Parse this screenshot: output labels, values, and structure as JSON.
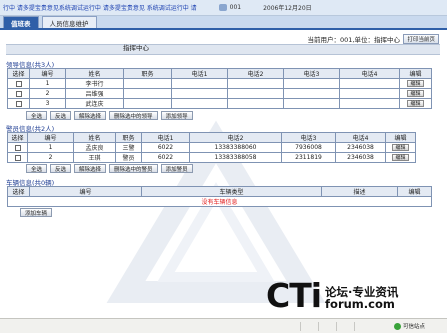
{
  "ticker": {
    "text": "行中 请多提宝贵意见系统调试运行中 请多提宝贵意见 系统调试运行中 请",
    "user_id": "001",
    "date": "2006年12月20日"
  },
  "tabs": [
    {
      "label": "值班表",
      "active": true
    },
    {
      "label": "人员信息维护",
      "active": false
    }
  ],
  "header": {
    "current_user": "当前用户：001,单位：指挥中心",
    "print_label": "打印当前页",
    "center_title": "指挥中心"
  },
  "leaders": {
    "title": "领导信息(共3人)",
    "columns": [
      "选择",
      "编号",
      "姓名",
      "职务",
      "电话1",
      "电话2",
      "电话3",
      "电话4",
      "编辑"
    ],
    "rows": [
      {
        "no": "1",
        "name": "李书行",
        "title": "",
        "tel1": "",
        "tel2": "",
        "tel3": "",
        "tel4": "",
        "edit": "编辑"
      },
      {
        "no": "2",
        "name": "吕维强",
        "title": "",
        "tel1": "",
        "tel2": "",
        "tel3": "",
        "tel4": "",
        "edit": "编辑"
      },
      {
        "no": "3",
        "name": "武连庆",
        "title": "",
        "tel1": "",
        "tel2": "",
        "tel3": "",
        "tel4": "",
        "edit": "编辑"
      }
    ],
    "buttons": [
      "全选",
      "反选",
      "解除选择",
      "删除选中的领导",
      "添加领导"
    ]
  },
  "police": {
    "title": "警员信息(共2人)",
    "columns": [
      "选择",
      "编号",
      "姓名",
      "职务",
      "电话1",
      "电话2",
      "电话3",
      "电话4",
      "编辑"
    ],
    "rows": [
      {
        "no": "1",
        "name": "孟庆良",
        "title": "三警",
        "tel1": "6022",
        "tel2": "13383388060",
        "tel3": "7936008",
        "tel4": "2346038",
        "edit": "编辑"
      },
      {
        "no": "2",
        "name": "王琪",
        "title": "警员",
        "tel1": "6022",
        "tel2": "13383388058",
        "tel3": "2311819",
        "tel4": "2346038",
        "edit": "编辑"
      }
    ],
    "buttons": [
      "全选",
      "反选",
      "解除选择",
      "删除选中的警员",
      "添加警员"
    ]
  },
  "vehicles": {
    "title": "车辆信息(共0辆)",
    "columns": [
      "选择",
      "编号",
      "车辆类型",
      "描述",
      "编辑"
    ],
    "empty_text": "没有车辆信息",
    "buttons": [
      "添加车辆"
    ]
  },
  "logo": {
    "big": "CTi",
    "line1": "论坛·专业资讯",
    "line2": "forum.com"
  },
  "statusbar": {
    "trusted": "可信站点"
  }
}
